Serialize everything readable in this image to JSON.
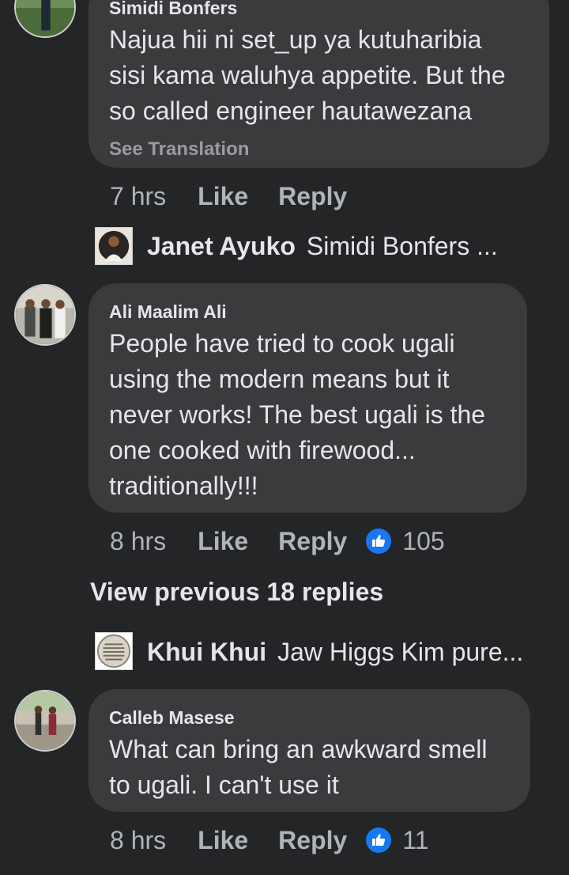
{
  "comments": [
    {
      "author": "Simidi Bonfers",
      "text": "Najua hii ni set_up ya kutuharibia\nsisi kama waluhya appetite. But the\nso called engineer hautawezana",
      "see_translation": "See Translation",
      "time": "7 hrs",
      "like_label": "Like",
      "reply_label": "Reply",
      "reaction_count": ""
    },
    {
      "author": "Ali Maalim Ali",
      "text": "People have tried to cook ugali\nusing the modern means but it\nnever works! The best ugali is the\none cooked with firewood...\ntraditionally!!!",
      "time": "8 hrs",
      "like_label": "Like",
      "reply_label": "Reply",
      "reaction_count": "105"
    },
    {
      "author": "Calleb Masese",
      "text": "What can bring an awkward smell\nto ugali. I can't use it",
      "time": "8 hrs",
      "like_label": "Like",
      "reply_label": "Reply",
      "reaction_count": "11"
    }
  ],
  "reply_previews": [
    {
      "name": "Janet Ayuko",
      "text": "Simidi Bonfers ..."
    },
    {
      "name": "Khui Khui",
      "text": "Jaw Higgs Kim pure..."
    }
  ],
  "view_previous_label": "View previous 18 replies",
  "colors": {
    "background": "#242526",
    "bubble": "#3a3b3c",
    "text": "#e4e6eb",
    "secondary_text": "#b0b3b8",
    "like_blue": "#1877f2"
  },
  "icons": [
    "thumbs-up-icon"
  ]
}
